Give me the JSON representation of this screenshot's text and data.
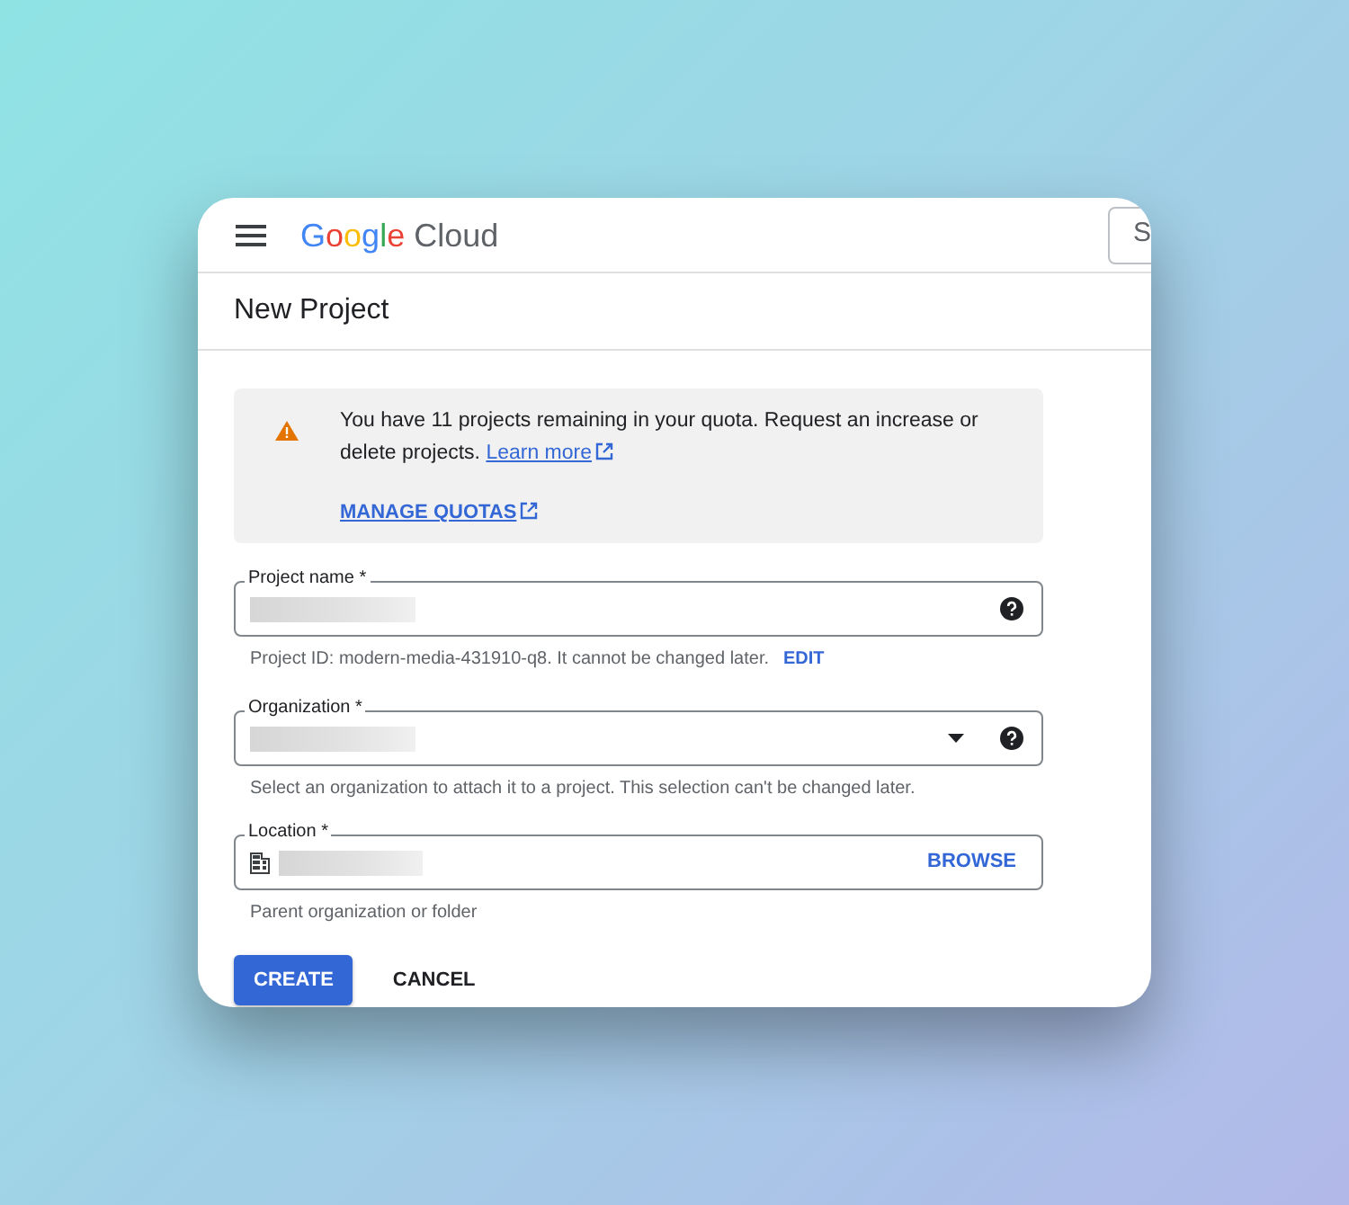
{
  "header": {
    "brand": "Google",
    "product": "Cloud",
    "search": {
      "placeholder": "S"
    }
  },
  "page_title": "New Project",
  "alert": {
    "message": "You have 11 projects remaining in your quota. Request an increase or delete projects.",
    "link": "Learn more",
    "action": "MANAGE QUOTAS"
  },
  "fields": [
    {
      "kind": "text",
      "label": "Project name *",
      "redacted": true,
      "help": true,
      "helper": "Project ID: modern-media-431910-q8. It cannot be changed later.",
      "helper_action": "EDIT"
    },
    {
      "kind": "select",
      "label": "Organization *",
      "redacted": true,
      "help": true,
      "helper": "Select an organization to attach it to a project. This selection can't be changed later."
    },
    {
      "kind": "browse",
      "label": "Location *",
      "redacted": true,
      "action": "BROWSE",
      "helper": "Parent organization or folder"
    }
  ],
  "buttons": [
    {
      "label": "CREATE",
      "kind": "primary"
    },
    {
      "label": "CANCEL",
      "kind": "text"
    }
  ]
}
